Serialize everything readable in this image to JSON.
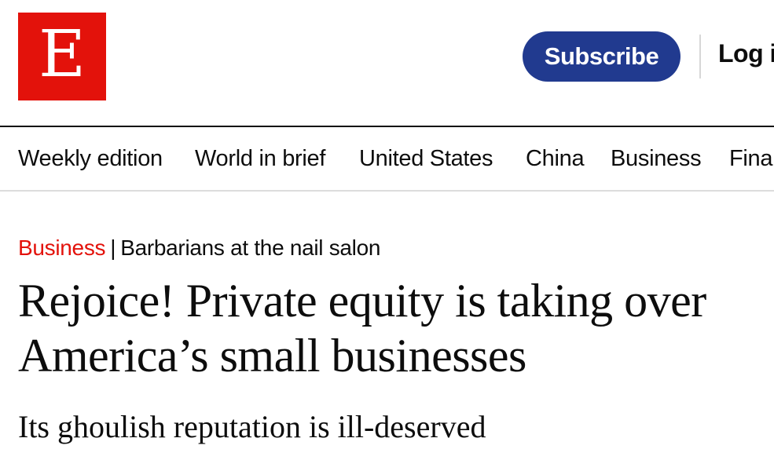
{
  "header": {
    "logo_letter": "E",
    "subscribe_label": "Subscribe",
    "login_label": "Log i"
  },
  "nav": {
    "items": [
      {
        "label": "Weekly edition"
      },
      {
        "label": "World in brief"
      },
      {
        "label": "United States"
      },
      {
        "label": "China"
      },
      {
        "label": "Business"
      },
      {
        "label": "Fina"
      }
    ]
  },
  "article": {
    "section": "Business",
    "separator": "|",
    "fly_title": "Barbarians at the nail salon",
    "headline": "Rejoice! Private equity is taking over America’s small businesses",
    "subheadline": "Its ghoulish reputation is ill-deserved"
  },
  "colors": {
    "brand_red": "#e3120b",
    "subscribe_blue": "#213a8f",
    "text": "#0d0d0d",
    "rule_light": "#dcdcdc"
  }
}
